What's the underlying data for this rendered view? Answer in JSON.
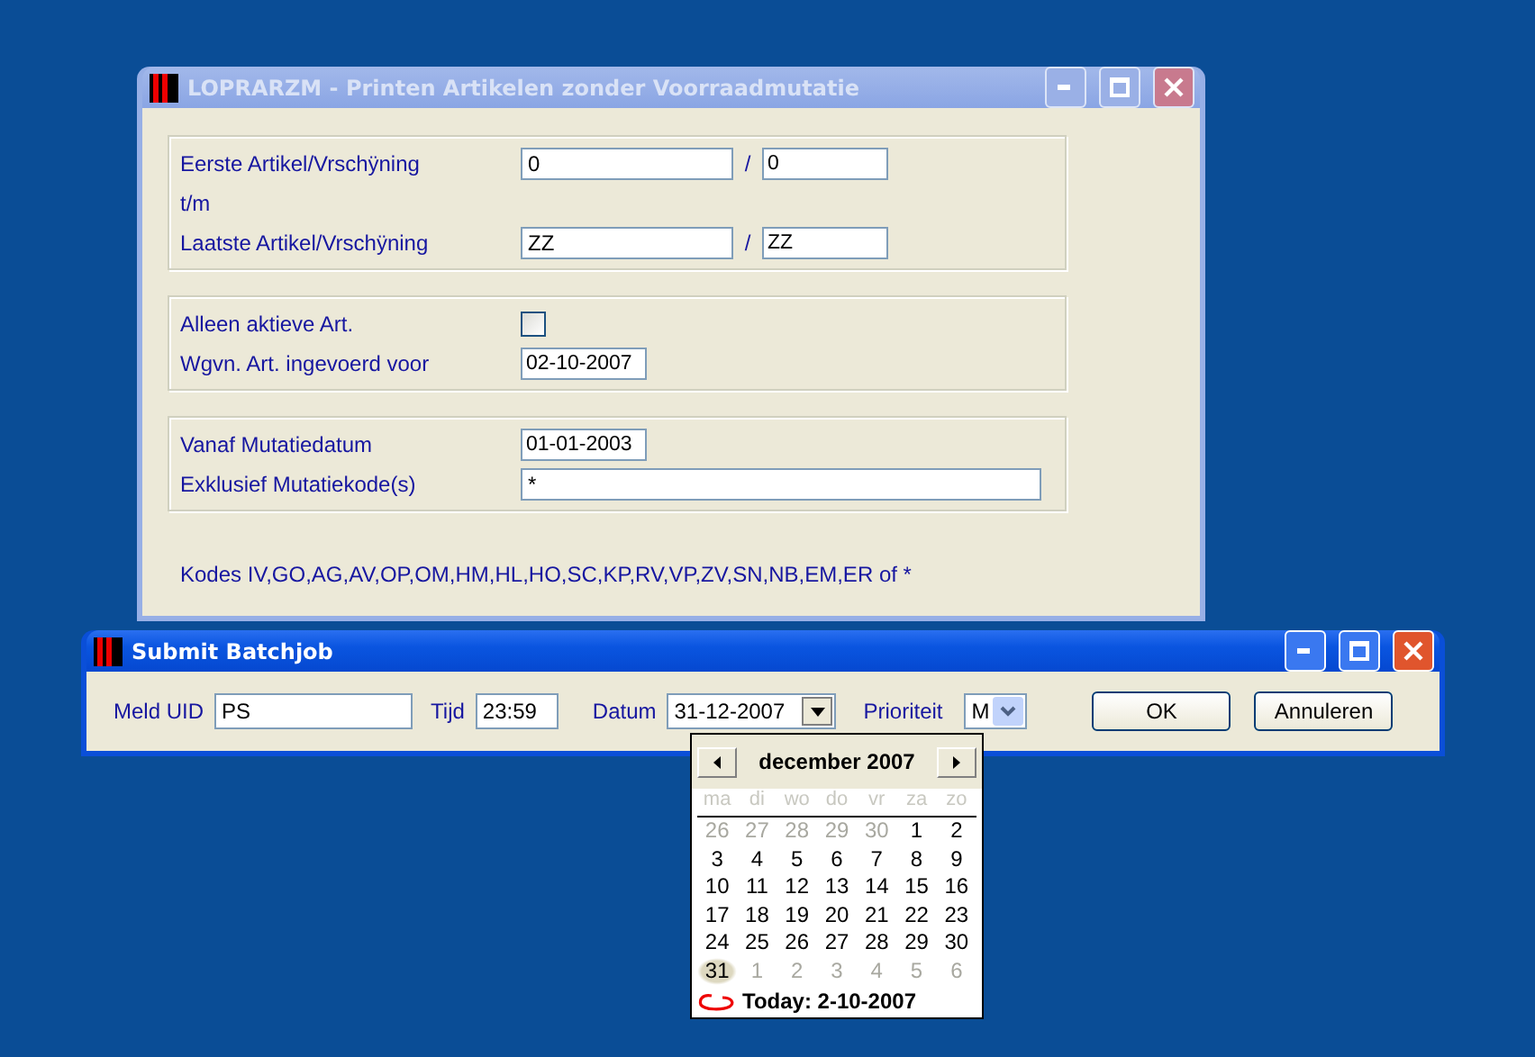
{
  "main_window": {
    "title": "LOPRARZM - Printen Artikelen zonder Voorraadmutatie",
    "active": false,
    "groups": [
      {
        "rows": [
          {
            "kind": "range",
            "label": "Eerste  Artikel/Vrschÿning",
            "from": "0",
            "separator": "/",
            "to": "0"
          },
          {
            "kind": "text",
            "label": "t/m"
          },
          {
            "kind": "range",
            "label": "Laatste Artikel/Vrschÿning",
            "from": "ZZ",
            "separator": "/",
            "to": "ZZ"
          }
        ]
      },
      {
        "rows": [
          {
            "kind": "checkbox",
            "label": "Alleen aktieve Art.",
            "checked": false
          },
          {
            "kind": "date",
            "label": "Wgvn. Art. ingevoerd voor",
            "value": "02-10-2007"
          }
        ]
      },
      {
        "rows": [
          {
            "kind": "date",
            "label": "Vanaf Mutatiedatum",
            "value": "01-01-2003"
          },
          {
            "kind": "wide",
            "label": "Exklusief Mutatiekode(s)",
            "value": "*"
          }
        ]
      }
    ],
    "note": "Kodes IV,GO,AG,AV,OP,OM,HM,HL,HO,SC,KP,RV,VP,ZV,SN,NB,EM,ER of *"
  },
  "batch_window": {
    "title": "Submit Batchjob",
    "active": true,
    "uid": {
      "label": "Meld UID",
      "value": "PS"
    },
    "time": {
      "label": "Tijd",
      "value": "23:59"
    },
    "date": {
      "label": "Datum",
      "value": "31-12-2007"
    },
    "priority": {
      "label": "Prioriteit",
      "value": "M"
    },
    "buttons": [
      "OK",
      "Annuleren"
    ]
  },
  "calendar": {
    "month": "december 2007",
    "weekdays": [
      "ma",
      "di",
      "wo",
      "do",
      "vr",
      "za",
      "zo"
    ],
    "days": [
      {
        "text": "26",
        "in_month": false,
        "selected": false
      },
      {
        "text": "27",
        "in_month": false,
        "selected": false
      },
      {
        "text": "28",
        "in_month": false,
        "selected": false
      },
      {
        "text": "29",
        "in_month": false,
        "selected": false
      },
      {
        "text": "30",
        "in_month": false,
        "selected": false
      },
      {
        "text": "1",
        "in_month": true,
        "selected": false
      },
      {
        "text": "2",
        "in_month": true,
        "selected": false
      },
      {
        "text": "3",
        "in_month": true,
        "selected": false
      },
      {
        "text": "4",
        "in_month": true,
        "selected": false
      },
      {
        "text": "5",
        "in_month": true,
        "selected": false
      },
      {
        "text": "6",
        "in_month": true,
        "selected": false
      },
      {
        "text": "7",
        "in_month": true,
        "selected": false
      },
      {
        "text": "8",
        "in_month": true,
        "selected": false
      },
      {
        "text": "9",
        "in_month": true,
        "selected": false
      },
      {
        "text": "10",
        "in_month": true,
        "selected": false
      },
      {
        "text": "11",
        "in_month": true,
        "selected": false
      },
      {
        "text": "12",
        "in_month": true,
        "selected": false
      },
      {
        "text": "13",
        "in_month": true,
        "selected": false
      },
      {
        "text": "14",
        "in_month": true,
        "selected": false
      },
      {
        "text": "15",
        "in_month": true,
        "selected": false
      },
      {
        "text": "16",
        "in_month": true,
        "selected": false
      },
      {
        "text": "17",
        "in_month": true,
        "selected": false
      },
      {
        "text": "18",
        "in_month": true,
        "selected": false
      },
      {
        "text": "19",
        "in_month": true,
        "selected": false
      },
      {
        "text": "20",
        "in_month": true,
        "selected": false
      },
      {
        "text": "21",
        "in_month": true,
        "selected": false
      },
      {
        "text": "22",
        "in_month": true,
        "selected": false
      },
      {
        "text": "23",
        "in_month": true,
        "selected": false
      },
      {
        "text": "24",
        "in_month": true,
        "selected": false
      },
      {
        "text": "25",
        "in_month": true,
        "selected": false
      },
      {
        "text": "26",
        "in_month": true,
        "selected": false
      },
      {
        "text": "27",
        "in_month": true,
        "selected": false
      },
      {
        "text": "28",
        "in_month": true,
        "selected": false
      },
      {
        "text": "29",
        "in_month": true,
        "selected": false
      },
      {
        "text": "30",
        "in_month": true,
        "selected": false
      },
      {
        "text": "31",
        "in_month": true,
        "selected": true
      },
      {
        "text": "1",
        "in_month": false,
        "selected": false
      },
      {
        "text": "2",
        "in_month": false,
        "selected": false
      },
      {
        "text": "3",
        "in_month": false,
        "selected": false
      },
      {
        "text": "4",
        "in_month": false,
        "selected": false
      },
      {
        "text": "5",
        "in_month": false,
        "selected": false
      },
      {
        "text": "6",
        "in_month": false,
        "selected": false
      }
    ],
    "today": "Today: 2-10-2007"
  }
}
